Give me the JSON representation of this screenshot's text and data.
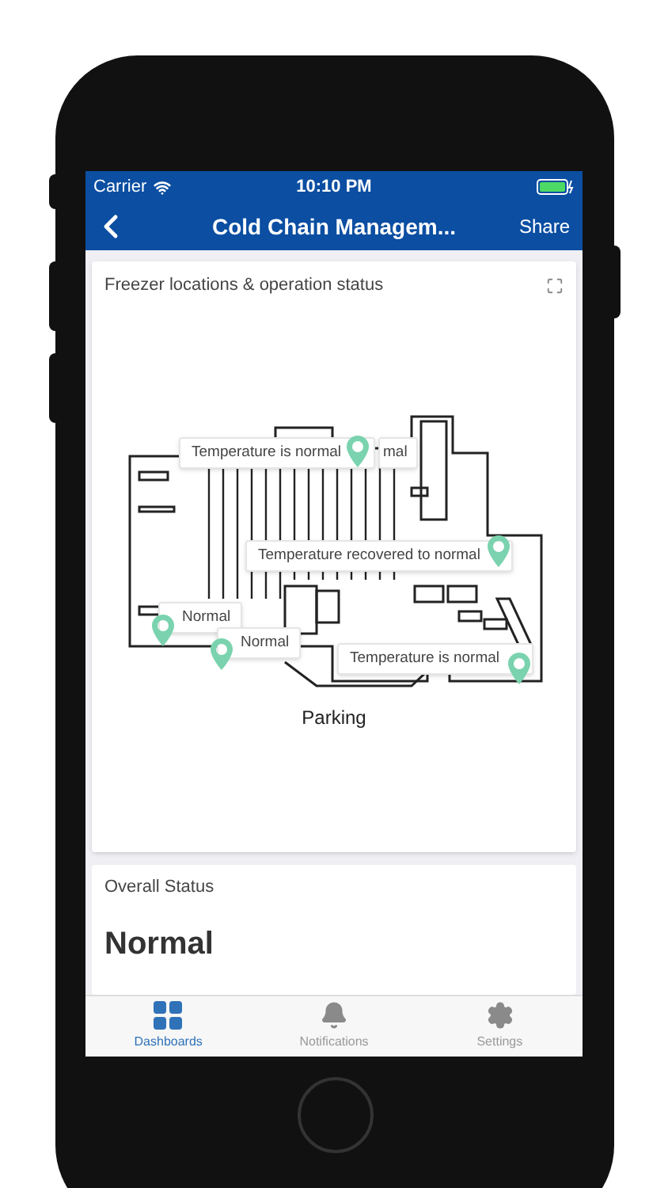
{
  "status_bar": {
    "carrier": "Carrier",
    "time": "10:10 PM"
  },
  "nav": {
    "title": "Cold Chain Managem...",
    "action": "Share"
  },
  "map_card": {
    "title": "Freezer locations & operation status",
    "caption": "Parking",
    "markers": [
      {
        "text": "mal"
      },
      {
        "text": "Temperature is normal"
      },
      {
        "text": "Temperature recovered to normal"
      },
      {
        "text": "Normal"
      },
      {
        "text": "Normal"
      },
      {
        "text": "Temperature is normal"
      }
    ]
  },
  "status_card": {
    "title": "Overall Status",
    "value": "Normal"
  },
  "tabs": [
    {
      "label": "Dashboards",
      "selected": true
    },
    {
      "label": "Notifications",
      "selected": false
    },
    {
      "label": "Settings",
      "selected": false
    }
  ]
}
